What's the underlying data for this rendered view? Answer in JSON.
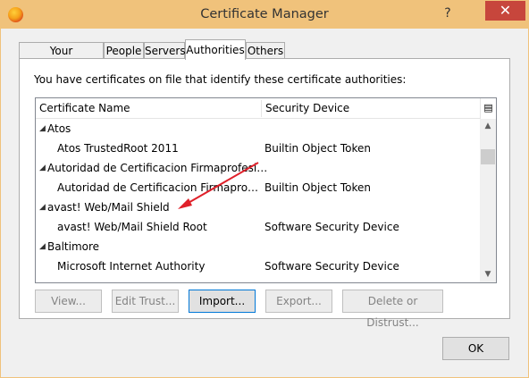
{
  "window": {
    "title": "Certificate Manager",
    "help_glyph": "?",
    "close_glyph": "✕"
  },
  "tabs": [
    {
      "label": "Your Certificates"
    },
    {
      "label": "People"
    },
    {
      "label": "Servers"
    },
    {
      "label": "Authorities",
      "active": true
    },
    {
      "label": "Others"
    }
  ],
  "panel": {
    "intro": "You have certificates on file that identify these certificate authorities:"
  },
  "table": {
    "columns": [
      "Certificate Name",
      "Security Device"
    ],
    "rows": [
      {
        "type": "group",
        "name": "Atos",
        "device": ""
      },
      {
        "type": "item",
        "name": "Atos TrustedRoot 2011",
        "device": "Builtin Object Token"
      },
      {
        "type": "group",
        "name": "Autoridad de Certificacion Firmaprofesiona...",
        "device": ""
      },
      {
        "type": "item",
        "name": "Autoridad de Certificacion Firmaprofesio...",
        "device": "Builtin Object Token"
      },
      {
        "type": "group",
        "name": "avast! Web/Mail Shield",
        "device": ""
      },
      {
        "type": "item",
        "name": "avast! Web/Mail Shield Root",
        "device": "Software Security Device"
      },
      {
        "type": "group",
        "name": "Baltimore",
        "device": ""
      },
      {
        "type": "item",
        "name": "Microsoft Internet Authority",
        "device": "Software Security Device"
      }
    ]
  },
  "buttons": {
    "view": "View...",
    "edit_trust": "Edit Trust...",
    "import": "Import...",
    "export": "Export...",
    "delete": "Delete or Distrust...",
    "ok": "OK"
  },
  "colors": {
    "titlebar": "#f0c27b",
    "close": "#c7463c",
    "annotation_arrow": "#e0202a"
  }
}
